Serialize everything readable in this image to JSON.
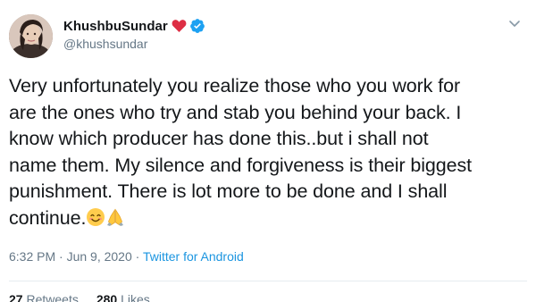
{
  "author": {
    "display_name": "KhushbuSundar",
    "handle": "@khushsundar",
    "heart_icon": "red-heart-icon",
    "verified_icon": "verified-badge-icon",
    "verified_color": "#1da1f2"
  },
  "tweet": {
    "lines": [
      "Very unfortunately you realize those who you work for",
      "are the ones who try and stab you behind your back. I",
      "know which producer has done this..but i shall not",
      "name them. My silence and forgiveness is their biggest",
      "punishment. There is lot more to be done and I shall",
      "continue."
    ],
    "emojis": [
      "smiling-face-icon",
      "folded-hands-icon"
    ]
  },
  "meta": {
    "time_date": "6:32 PM · Jun 9, 2020 · ",
    "source": "Twitter for Android",
    "link_color": "#1b95e0"
  },
  "stats": {
    "retweets_count": "27",
    "retweets_label": "Retweets",
    "likes_count": "280",
    "likes_label": "Likes"
  }
}
